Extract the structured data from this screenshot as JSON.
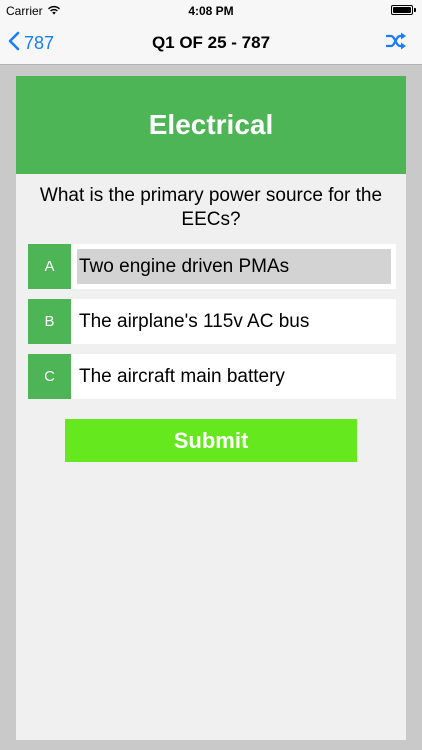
{
  "status_bar": {
    "carrier": "Carrier",
    "time": "4:08 PM"
  },
  "nav": {
    "back_label": "787",
    "title": "Q1 OF 25 - 787",
    "shuffle_icon": "shuffle-icon"
  },
  "quiz": {
    "category": "Electrical",
    "question": "What is the primary power source for the EECs?",
    "answers": [
      {
        "letter": "A",
        "text": "Two engine driven PMAs",
        "selected": true
      },
      {
        "letter": "B",
        "text": "The airplane's 115v AC bus",
        "selected": false
      },
      {
        "letter": "C",
        "text": "The aircraft main battery",
        "selected": false
      }
    ],
    "submit_label": "Submit"
  },
  "colors": {
    "accent_green": "#4db556",
    "submit_green": "#66e81e",
    "ios_blue": "#1a7dfa",
    "selected_gray": "#d3d3d3"
  }
}
